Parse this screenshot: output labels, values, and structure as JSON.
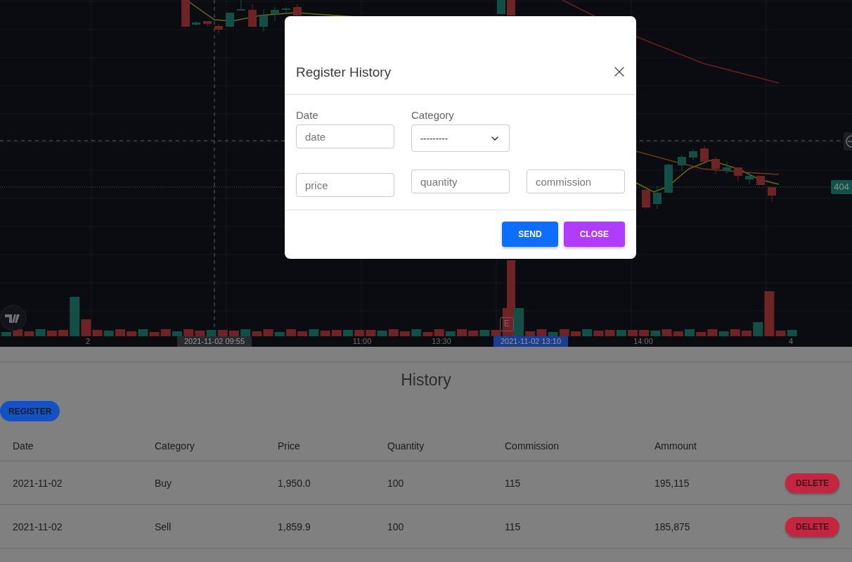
{
  "chart": {
    "price_label": "404",
    "event_marker": "E",
    "time_labels": [
      {
        "text": "2",
        "kind": "tick"
      },
      {
        "text": "2021-11-02  09:55",
        "kind": "crosshair"
      },
      {
        "text": "11:00",
        "kind": "tick"
      },
      {
        "text": "13:30",
        "kind": "tick"
      },
      {
        "text": "2021-11-02  13:10",
        "kind": "marker"
      },
      {
        "text": "14:00",
        "kind": "tick"
      },
      {
        "text": "4",
        "kind": "tick"
      }
    ]
  },
  "history": {
    "title": "History",
    "register_button": "REGISTER",
    "table": {
      "columns": [
        "Date",
        "Category",
        "Price",
        "Quantity",
        "Commission",
        "Ammount"
      ],
      "rows": [
        {
          "cells": [
            "2021-11-02",
            "Buy",
            "1,950.0",
            "100",
            "115",
            "195,115"
          ],
          "action": "DELETE"
        },
        {
          "cells": [
            "2021-11-02",
            "Sell",
            "1,859.9",
            "100",
            "115",
            "185,875"
          ],
          "action": "DELETE"
        }
      ]
    }
  },
  "dialog": {
    "title": "Register History",
    "date_label": "Date",
    "category_label": "Category",
    "date_field": {
      "placeholder": "date"
    },
    "category_select": {
      "value": "---------"
    },
    "fields": [
      {
        "placeholder": "price"
      },
      {
        "placeholder": "quantity"
      },
      {
        "placeholder": "commission"
      }
    ],
    "buttons": [
      {
        "label": "SEND",
        "kind": "primary"
      },
      {
        "label": "CLOSE",
        "kind": "secondary"
      }
    ]
  }
}
